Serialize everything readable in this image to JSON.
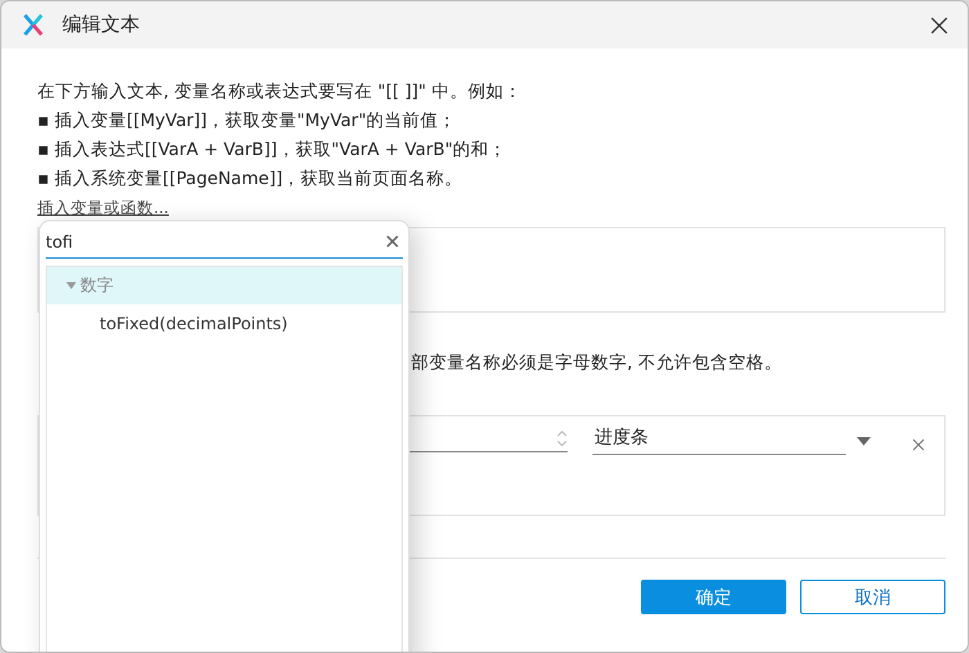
{
  "window": {
    "title": "编辑文本"
  },
  "instructions": [
    "在下方输入文本, 变量名称或表达式要写在 \"[[ ]]\" 中。例如：",
    "▪ 插入变量[[MyVar]]，获取变量\"MyVar\"的当前值；",
    "▪ 插入表达式[[VarA + VarB]]，获取\"VarA + VarB\"的和；",
    "▪ 插入系统变量[[PageName]]，获取当前页面名称。"
  ],
  "insert_link": "插入变量或函数...",
  "note": "部变量名称必须是字母数字, 不允许包含空格。",
  "variable_row": {
    "widget_select": "进度条"
  },
  "buttons": [
    {
      "label": "确定",
      "kind": "primary"
    },
    {
      "label": "取消",
      "kind": "secondary"
    }
  ],
  "popup": {
    "search": {
      "value": "tofi"
    },
    "tree": [
      {
        "label": "数字",
        "expanded": true,
        "selected": true,
        "children": [
          {
            "label": "toFixed(decimalPoints)",
            "selected": false
          }
        ]
      }
    ]
  }
}
